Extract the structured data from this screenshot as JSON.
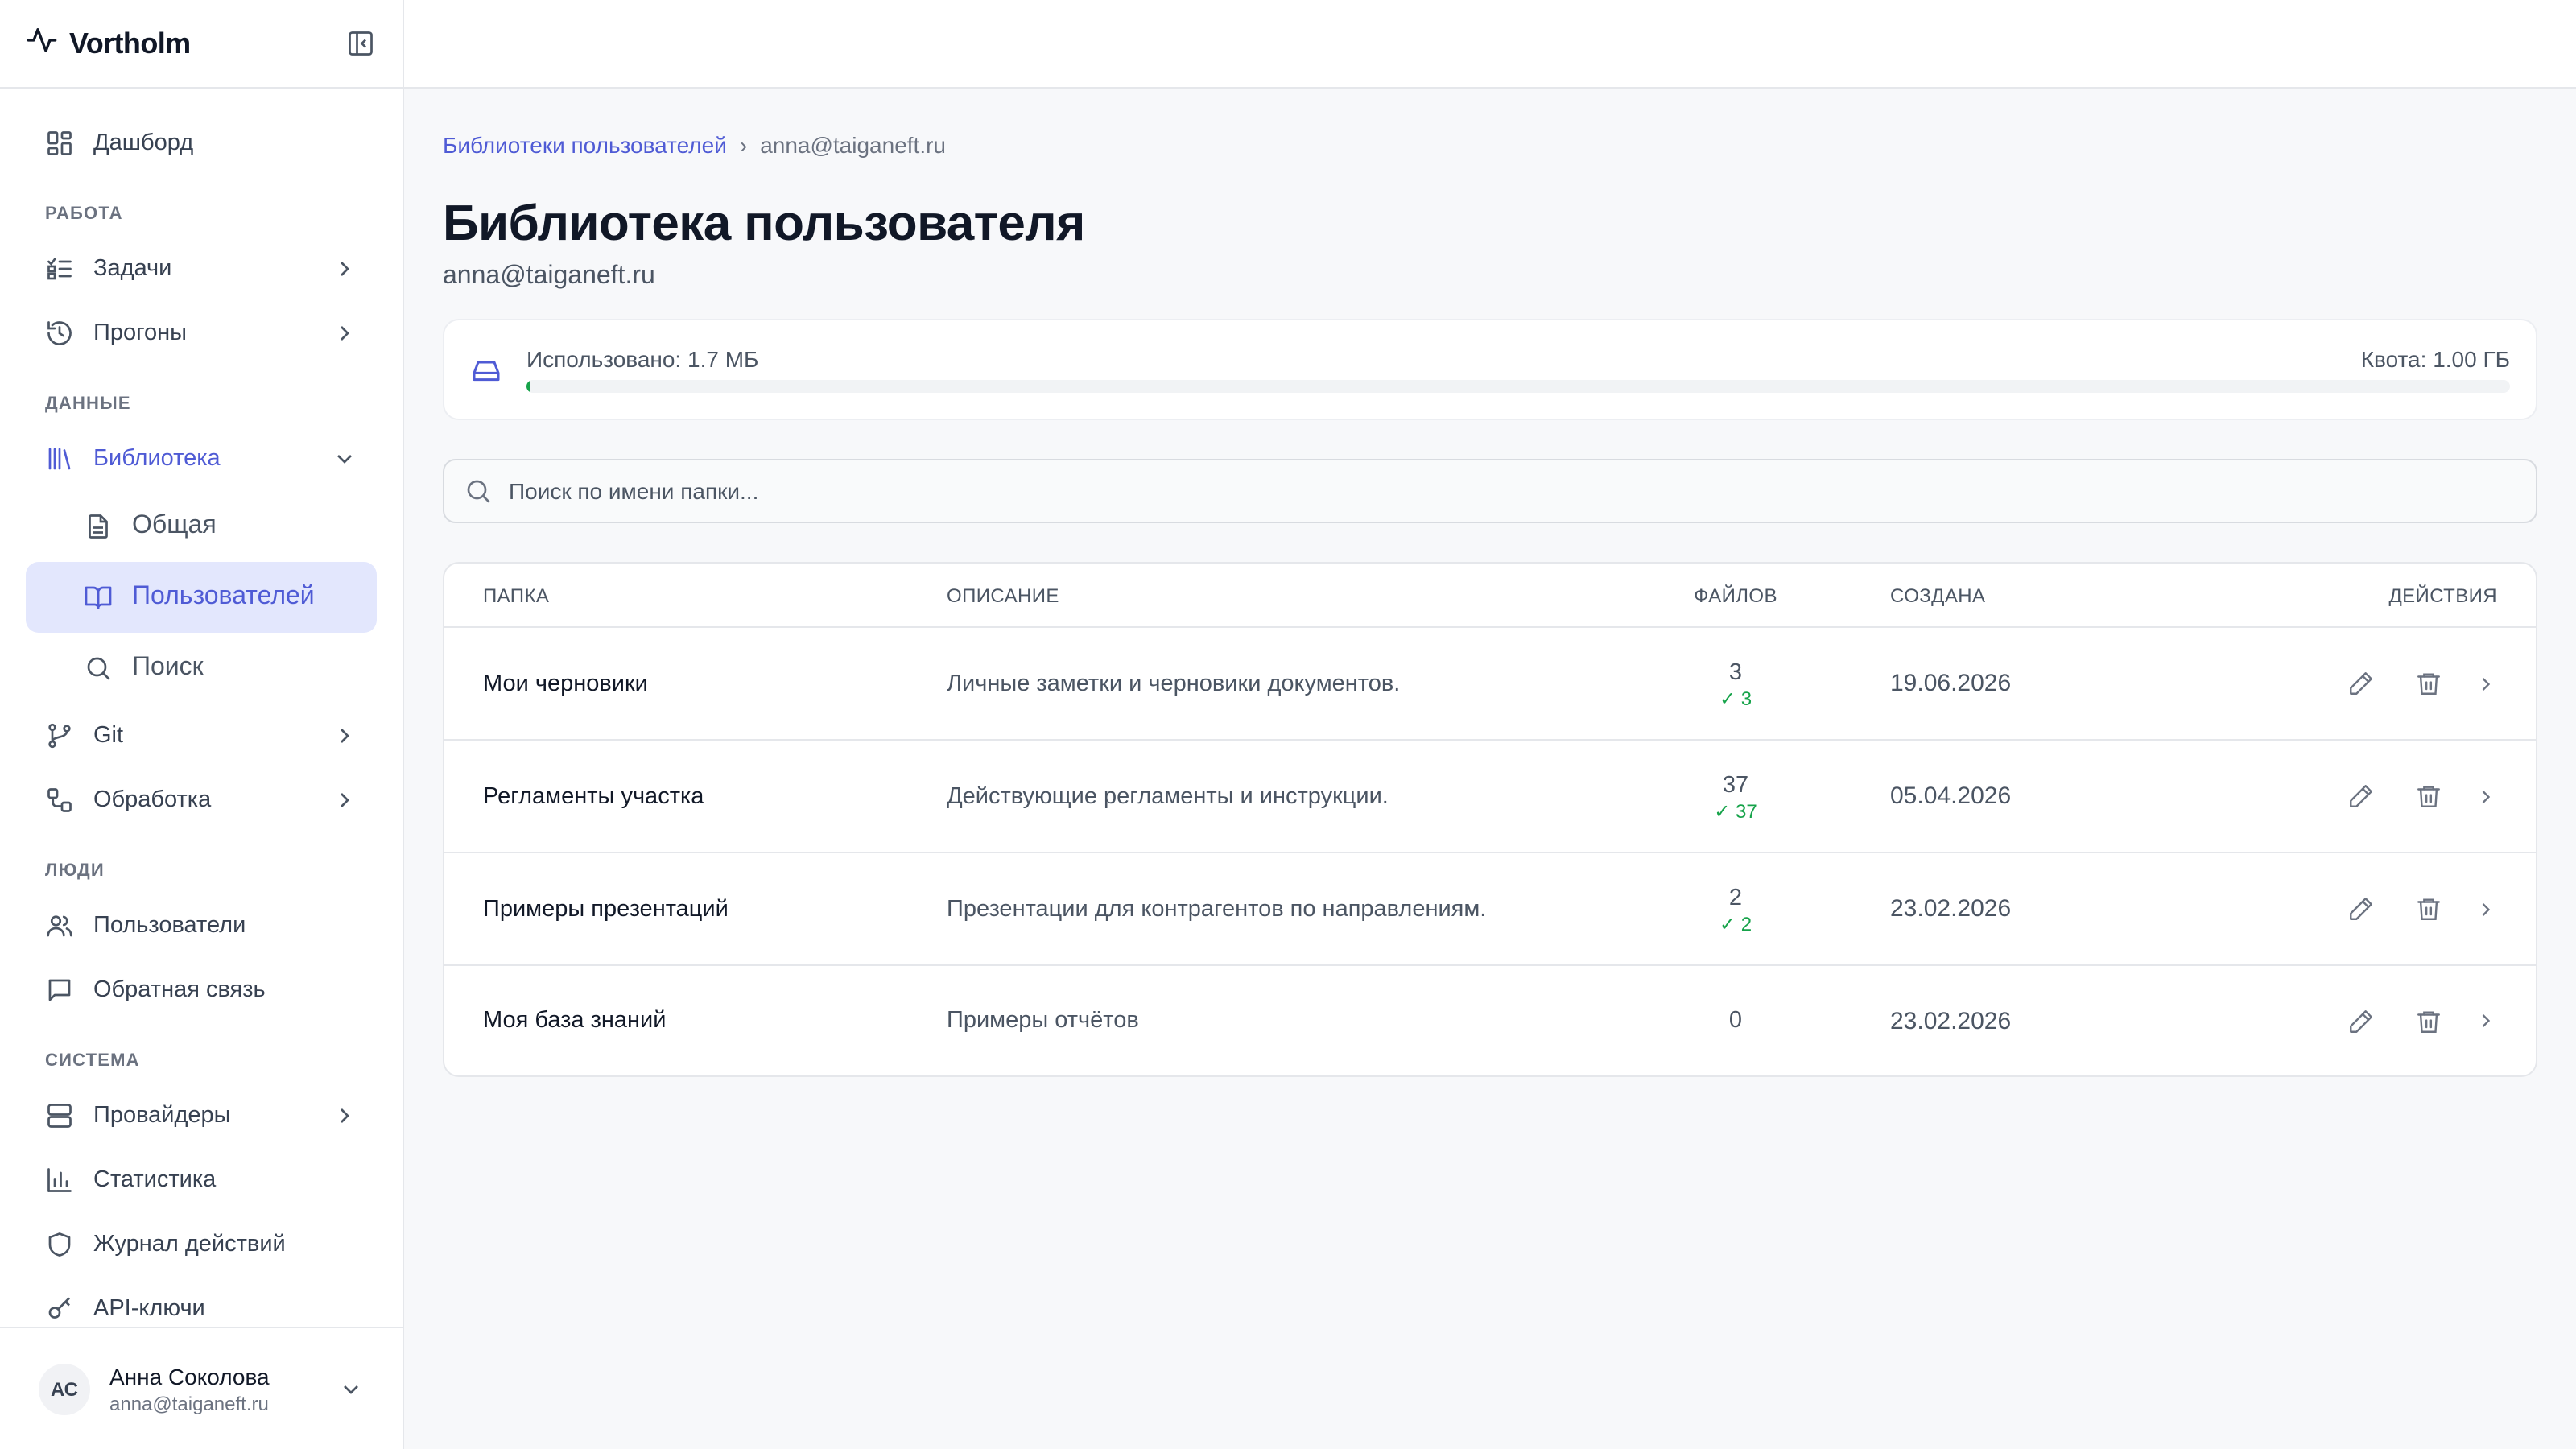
{
  "app": {
    "name": "Vortholm"
  },
  "sidebar": {
    "dashboard": "Дашборд",
    "sections": {
      "work": "РАБОТА",
      "data": "ДАННЫЕ",
      "people": "ЛЮДИ",
      "system": "СИСТЕМА"
    },
    "tasks": "Задачи",
    "runs": "Прогоны",
    "library": "Библиотека",
    "library_general": "Общая",
    "library_users": "Пользователей",
    "library_search": "Поиск",
    "git": "Git",
    "processing": "Обработка",
    "users": "Пользователи",
    "feedback": "Обратная связь",
    "providers": "Провайдеры",
    "stats": "Статистика",
    "audit": "Журнал действий",
    "api_keys": "API-ключи"
  },
  "user": {
    "initials": "АС",
    "name": "Анна Соколова",
    "email": "anna@taiganeft.ru"
  },
  "breadcrumb": {
    "parent": "Библиотеки пользователей",
    "sep": "›",
    "current": "anna@taiganeft.ru"
  },
  "page": {
    "title": "Библиотека пользователя",
    "subtitle": "anna@taiganeft.ru"
  },
  "quota": {
    "used_label": "Использовано: 1.7 МБ",
    "quota_label": "Квота: 1.00 ГБ",
    "used_fraction": 0.0017,
    "bar_color": "#16a34a"
  },
  "search": {
    "placeholder": "Поиск по имени папки..."
  },
  "table": {
    "headers": {
      "folder": "Папка",
      "description": "Описание",
      "files": "Файлов",
      "created": "Создана",
      "actions": "Действия"
    },
    "rows": [
      {
        "name": "Мои черновики",
        "description": "Личные заметки и черновики документов.",
        "files": "3",
        "ok": "✓ 3",
        "created": "19.06.2026"
      },
      {
        "name": "Регламенты участка",
        "description": "Действующие регламенты и инструкции.",
        "files": "37",
        "ok": "✓ 37",
        "created": "05.04.2026"
      },
      {
        "name": "Примеры презентаций",
        "description": "Презентации для контрагентов по направлениям.",
        "files": "2",
        "ok": "✓ 2",
        "created": "23.02.2026"
      },
      {
        "name": "Моя база знаний",
        "description": "Примеры отчётов",
        "files": "0",
        "ok": "",
        "created": "23.02.2026"
      }
    ]
  },
  "colors": {
    "accent": "#4f5bd5",
    "accent_bg": "#e3e7fd",
    "success": "#16a34a"
  }
}
